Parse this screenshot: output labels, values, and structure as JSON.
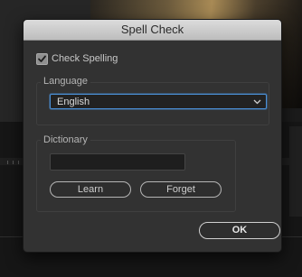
{
  "dialog": {
    "title": "Spell Check",
    "check_spelling": {
      "label": "Check Spelling",
      "checked": true
    },
    "language": {
      "legend": "Language",
      "selected": "English"
    },
    "dictionary": {
      "legend": "Dictionary",
      "input_value": "",
      "learn_label": "Learn",
      "forget_label": "Forget"
    },
    "ok_label": "OK"
  },
  "colors": {
    "dialog_bg": "#323232",
    "titlebar": "#c8c8c8",
    "focus_ring": "#4a8fd6"
  }
}
